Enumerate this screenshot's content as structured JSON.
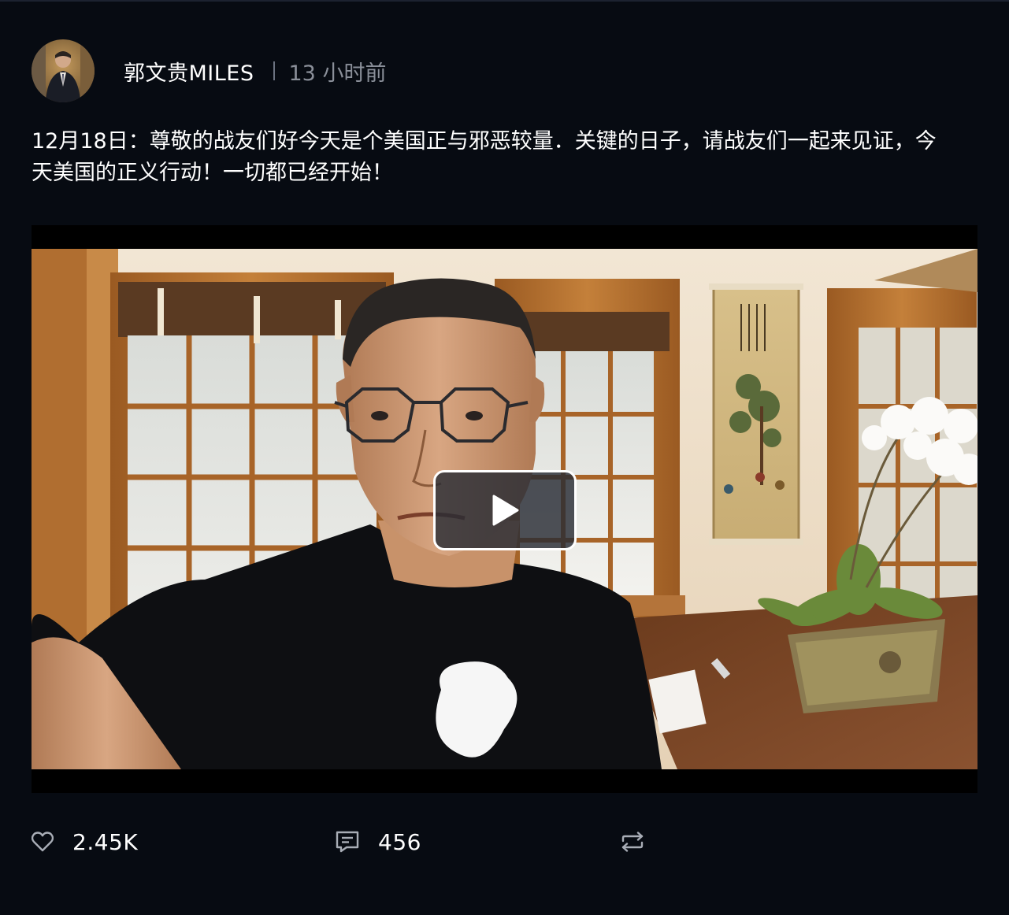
{
  "author": {
    "name": "郭文贵MILES",
    "avatar": "avatar-photo"
  },
  "post": {
    "time": "13 小时前",
    "text_line1": "12月18日：尊敬的战友们好今天是个美国正与邪恶较量．关键的日子，请战友们一起来见证，今",
    "text_line2": "天美国的正义行动！一切都已经开始！"
  },
  "video": {
    "thumbnail": "man-selfie-in-wooden-room",
    "play_icon": "play-icon"
  },
  "actions": {
    "likes": "2.45K",
    "comments": "456",
    "like_icon": "heart-icon",
    "comment_icon": "comment-icon",
    "repost_icon": "repost-icon"
  },
  "colors": {
    "background": "#070b12",
    "text": "#ffffff",
    "muted": "#8a8f99"
  }
}
